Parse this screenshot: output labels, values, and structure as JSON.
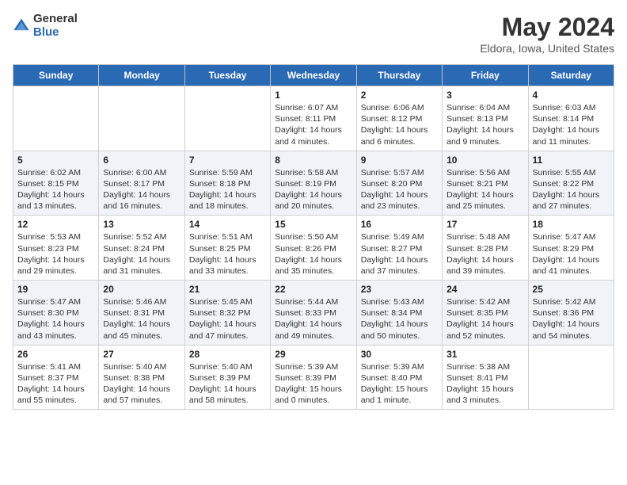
{
  "header": {
    "logo_general": "General",
    "logo_blue": "Blue",
    "month_title": "May 2024",
    "location": "Eldora, Iowa, United States"
  },
  "weekdays": [
    "Sunday",
    "Monday",
    "Tuesday",
    "Wednesday",
    "Thursday",
    "Friday",
    "Saturday"
  ],
  "weeks": [
    [
      {
        "day": "",
        "sunrise": "",
        "sunset": "",
        "daylight": ""
      },
      {
        "day": "",
        "sunrise": "",
        "sunset": "",
        "daylight": ""
      },
      {
        "day": "",
        "sunrise": "",
        "sunset": "",
        "daylight": ""
      },
      {
        "day": "1",
        "sunrise": "Sunrise: 6:07 AM",
        "sunset": "Sunset: 8:11 PM",
        "daylight": "Daylight: 14 hours and 4 minutes."
      },
      {
        "day": "2",
        "sunrise": "Sunrise: 6:06 AM",
        "sunset": "Sunset: 8:12 PM",
        "daylight": "Daylight: 14 hours and 6 minutes."
      },
      {
        "day": "3",
        "sunrise": "Sunrise: 6:04 AM",
        "sunset": "Sunset: 8:13 PM",
        "daylight": "Daylight: 14 hours and 9 minutes."
      },
      {
        "day": "4",
        "sunrise": "Sunrise: 6:03 AM",
        "sunset": "Sunset: 8:14 PM",
        "daylight": "Daylight: 14 hours and 11 minutes."
      }
    ],
    [
      {
        "day": "5",
        "sunrise": "Sunrise: 6:02 AM",
        "sunset": "Sunset: 8:15 PM",
        "daylight": "Daylight: 14 hours and 13 minutes."
      },
      {
        "day": "6",
        "sunrise": "Sunrise: 6:00 AM",
        "sunset": "Sunset: 8:17 PM",
        "daylight": "Daylight: 14 hours and 16 minutes."
      },
      {
        "day": "7",
        "sunrise": "Sunrise: 5:59 AM",
        "sunset": "Sunset: 8:18 PM",
        "daylight": "Daylight: 14 hours and 18 minutes."
      },
      {
        "day": "8",
        "sunrise": "Sunrise: 5:58 AM",
        "sunset": "Sunset: 8:19 PM",
        "daylight": "Daylight: 14 hours and 20 minutes."
      },
      {
        "day": "9",
        "sunrise": "Sunrise: 5:57 AM",
        "sunset": "Sunset: 8:20 PM",
        "daylight": "Daylight: 14 hours and 23 minutes."
      },
      {
        "day": "10",
        "sunrise": "Sunrise: 5:56 AM",
        "sunset": "Sunset: 8:21 PM",
        "daylight": "Daylight: 14 hours and 25 minutes."
      },
      {
        "day": "11",
        "sunrise": "Sunrise: 5:55 AM",
        "sunset": "Sunset: 8:22 PM",
        "daylight": "Daylight: 14 hours and 27 minutes."
      }
    ],
    [
      {
        "day": "12",
        "sunrise": "Sunrise: 5:53 AM",
        "sunset": "Sunset: 8:23 PM",
        "daylight": "Daylight: 14 hours and 29 minutes."
      },
      {
        "day": "13",
        "sunrise": "Sunrise: 5:52 AM",
        "sunset": "Sunset: 8:24 PM",
        "daylight": "Daylight: 14 hours and 31 minutes."
      },
      {
        "day": "14",
        "sunrise": "Sunrise: 5:51 AM",
        "sunset": "Sunset: 8:25 PM",
        "daylight": "Daylight: 14 hours and 33 minutes."
      },
      {
        "day": "15",
        "sunrise": "Sunrise: 5:50 AM",
        "sunset": "Sunset: 8:26 PM",
        "daylight": "Daylight: 14 hours and 35 minutes."
      },
      {
        "day": "16",
        "sunrise": "Sunrise: 5:49 AM",
        "sunset": "Sunset: 8:27 PM",
        "daylight": "Daylight: 14 hours and 37 minutes."
      },
      {
        "day": "17",
        "sunrise": "Sunrise: 5:48 AM",
        "sunset": "Sunset: 8:28 PM",
        "daylight": "Daylight: 14 hours and 39 minutes."
      },
      {
        "day": "18",
        "sunrise": "Sunrise: 5:47 AM",
        "sunset": "Sunset: 8:29 PM",
        "daylight": "Daylight: 14 hours and 41 minutes."
      }
    ],
    [
      {
        "day": "19",
        "sunrise": "Sunrise: 5:47 AM",
        "sunset": "Sunset: 8:30 PM",
        "daylight": "Daylight: 14 hours and 43 minutes."
      },
      {
        "day": "20",
        "sunrise": "Sunrise: 5:46 AM",
        "sunset": "Sunset: 8:31 PM",
        "daylight": "Daylight: 14 hours and 45 minutes."
      },
      {
        "day": "21",
        "sunrise": "Sunrise: 5:45 AM",
        "sunset": "Sunset: 8:32 PM",
        "daylight": "Daylight: 14 hours and 47 minutes."
      },
      {
        "day": "22",
        "sunrise": "Sunrise: 5:44 AM",
        "sunset": "Sunset: 8:33 PM",
        "daylight": "Daylight: 14 hours and 49 minutes."
      },
      {
        "day": "23",
        "sunrise": "Sunrise: 5:43 AM",
        "sunset": "Sunset: 8:34 PM",
        "daylight": "Daylight: 14 hours and 50 minutes."
      },
      {
        "day": "24",
        "sunrise": "Sunrise: 5:42 AM",
        "sunset": "Sunset: 8:35 PM",
        "daylight": "Daylight: 14 hours and 52 minutes."
      },
      {
        "day": "25",
        "sunrise": "Sunrise: 5:42 AM",
        "sunset": "Sunset: 8:36 PM",
        "daylight": "Daylight: 14 hours and 54 minutes."
      }
    ],
    [
      {
        "day": "26",
        "sunrise": "Sunrise: 5:41 AM",
        "sunset": "Sunset: 8:37 PM",
        "daylight": "Daylight: 14 hours and 55 minutes."
      },
      {
        "day": "27",
        "sunrise": "Sunrise: 5:40 AM",
        "sunset": "Sunset: 8:38 PM",
        "daylight": "Daylight: 14 hours and 57 minutes."
      },
      {
        "day": "28",
        "sunrise": "Sunrise: 5:40 AM",
        "sunset": "Sunset: 8:39 PM",
        "daylight": "Daylight: 14 hours and 58 minutes."
      },
      {
        "day": "29",
        "sunrise": "Sunrise: 5:39 AM",
        "sunset": "Sunset: 8:39 PM",
        "daylight": "Daylight: 15 hours and 0 minutes."
      },
      {
        "day": "30",
        "sunrise": "Sunrise: 5:39 AM",
        "sunset": "Sunset: 8:40 PM",
        "daylight": "Daylight: 15 hours and 1 minute."
      },
      {
        "day": "31",
        "sunrise": "Sunrise: 5:38 AM",
        "sunset": "Sunset: 8:41 PM",
        "daylight": "Daylight: 15 hours and 3 minutes."
      },
      {
        "day": "",
        "sunrise": "",
        "sunset": "",
        "daylight": ""
      }
    ]
  ]
}
